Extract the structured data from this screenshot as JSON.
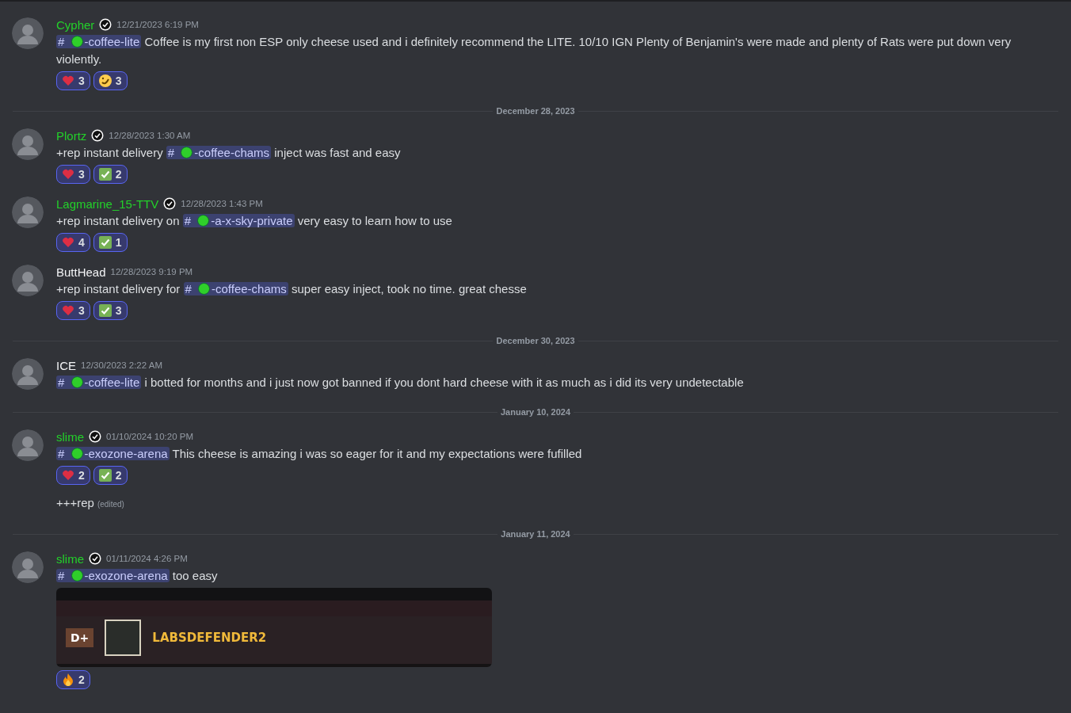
{
  "feed": [
    {
      "kind": "message",
      "author": "Cypher",
      "color": "#23d12a",
      "verified": true,
      "time": "12/21/2023 6:19 PM",
      "content": [
        {
          "kind": "mention",
          "hash": "#",
          "label": "-coffee-lite"
        },
        {
          "kind": "text",
          "text": "Coffee is my first non ESP only cheese used and i definitely recommend the LITE. 10/10 IGN Plenty of Benjamin's were made and plenty of Rats were put down very violently."
        }
      ],
      "reactions": [
        {
          "kind": "heart",
          "count": "3",
          "reacted": true
        },
        {
          "kind": "rofl",
          "count": "3",
          "reacted": true
        }
      ]
    },
    {
      "kind": "divider",
      "label": "December 28, 2023"
    },
    {
      "kind": "message",
      "author": "Plortz",
      "color": "#23d12a",
      "verified": true,
      "time": "12/28/2023 1:30 AM",
      "content": [
        {
          "kind": "text",
          "text": "+rep instant delivery"
        },
        {
          "kind": "mention",
          "hash": "#",
          "label": "-coffee-chams"
        },
        {
          "kind": "text",
          "text": "inject was fast and easy"
        }
      ],
      "reactions": [
        {
          "kind": "heart",
          "count": "3",
          "reacted": true
        },
        {
          "kind": "check",
          "count": "2",
          "reacted": true
        }
      ]
    },
    {
      "kind": "message",
      "author": "Lagmarine_15-TTV",
      "color": "#23d12a",
      "verified": true,
      "time": "12/28/2023 1:43 PM",
      "content": [
        {
          "kind": "text",
          "text": "+rep instant delivery on"
        },
        {
          "kind": "mention",
          "hash": "#",
          "label": "-a-x-sky-private"
        },
        {
          "kind": "text",
          "text": "very easy to learn how to use"
        }
      ],
      "reactions": [
        {
          "kind": "heart",
          "count": "4",
          "reacted": true
        },
        {
          "kind": "check",
          "count": "1",
          "reacted": true
        }
      ]
    },
    {
      "kind": "message",
      "author": "ButtHead",
      "color": "#f2f3f5",
      "verified": false,
      "time": "12/28/2023 9:19 PM",
      "content": [
        {
          "kind": "text",
          "text": "+rep instant delivery for"
        },
        {
          "kind": "mention",
          "hash": "#",
          "label": "-coffee-chams"
        },
        {
          "kind": "text",
          "text": "super easy inject, took no time. great chesse"
        }
      ],
      "reactions": [
        {
          "kind": "heart",
          "count": "3",
          "reacted": true
        },
        {
          "kind": "check",
          "count": "3",
          "reacted": true
        }
      ]
    },
    {
      "kind": "divider",
      "label": "December 30, 2023"
    },
    {
      "kind": "message",
      "author": "ICE",
      "color": "#f2f3f5",
      "verified": false,
      "time": "12/30/2023 2:22 AM",
      "content": [
        {
          "kind": "mention",
          "hash": "#",
          "label": "-coffee-lite"
        },
        {
          "kind": "text",
          "text": " i botted for months and i just now got banned if you dont hard cheese with it as much as i did its very undetectable"
        }
      ]
    },
    {
      "kind": "divider",
      "label": "January 10, 2024"
    },
    {
      "kind": "message",
      "author": "slime",
      "color": "#23d12a",
      "verified": true,
      "time": "01/10/2024 10:20 PM",
      "content": [
        {
          "kind": "mention",
          "hash": "#",
          "label": "-exozone-arena"
        },
        {
          "kind": "text",
          "text": "This cheese is amazing i was so eager for it and my expectations were fufilled"
        }
      ],
      "reactions": [
        {
          "kind": "heart",
          "count": "2",
          "reacted": true
        },
        {
          "kind": "check",
          "count": "2",
          "reacted": true
        }
      ],
      "followups": [
        {
          "text": "+++rep",
          "edited": "(edited)"
        }
      ]
    },
    {
      "kind": "divider",
      "label": "January 11, 2024"
    },
    {
      "kind": "message",
      "author": "slime",
      "color": "#23d12a",
      "verified": true,
      "time": "01/11/2024 4:26 PM",
      "content": [
        {
          "kind": "mention",
          "hash": "#",
          "label": "-exozone-arena"
        },
        {
          "kind": "text",
          "text": "too easy"
        }
      ],
      "attachment": {
        "rank": "D+",
        "player": "LABSDEFENDER2"
      },
      "reactions": [
        {
          "kind": "fire",
          "count": "2",
          "reacted": true
        }
      ]
    }
  ]
}
